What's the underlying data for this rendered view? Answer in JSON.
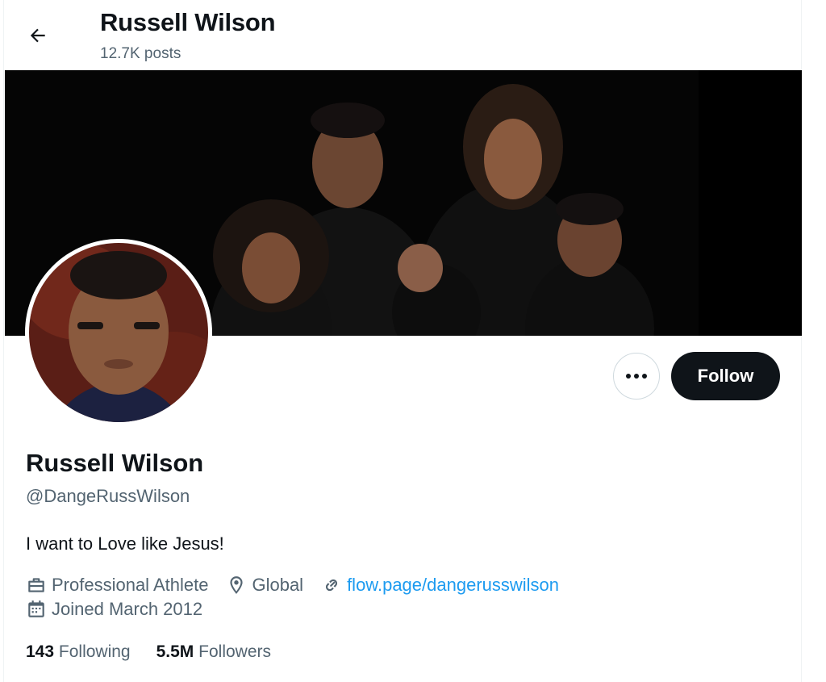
{
  "header": {
    "title": "Russell Wilson",
    "posts_count": "12.7K posts"
  },
  "profile": {
    "display_name": "Russell Wilson",
    "handle": "@DangeRussWilson",
    "bio": "I want to Love like Jesus!",
    "category": "Professional Athlete",
    "location": "Global",
    "website": "flow.page/dangerusswilson",
    "joined": "Joined March 2012"
  },
  "actions": {
    "follow_label": "Follow",
    "more_icon": "more-horizontal-icon"
  },
  "stats": {
    "following_count": "143",
    "following_label": "Following",
    "followers_count": "5.5M",
    "followers_label": "Followers"
  },
  "icons": {
    "back": "arrow-left-icon",
    "category": "briefcase-icon",
    "location": "location-pin-icon",
    "website": "link-icon",
    "joined": "calendar-icon"
  },
  "colors": {
    "accent": "#1d9bf0",
    "text": "#0f1419",
    "secondary": "#536471",
    "follow_bg": "#0f1419"
  }
}
